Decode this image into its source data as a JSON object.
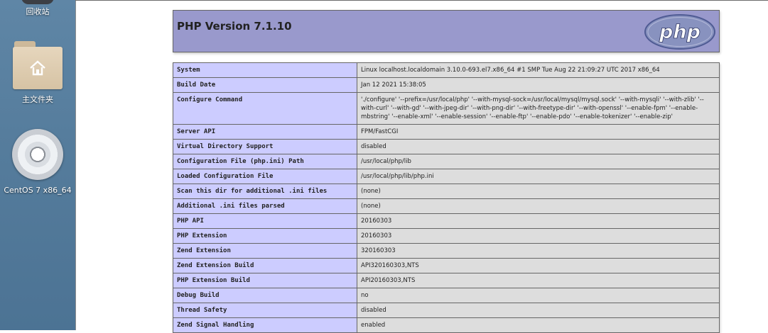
{
  "desktop": {
    "icons": [
      {
        "label": "回收站",
        "icon": "trash-icon"
      },
      {
        "label": "主文件夹",
        "icon": "home-folder-icon"
      },
      {
        "label": "CentOS 7 x86_64",
        "icon": "disc-icon"
      }
    ]
  },
  "header": {
    "title": "PHP Version 7.1.10",
    "logo_text": "php",
    "logo_color": "#8892bf"
  },
  "colors": {
    "header_bg": "#9999cc",
    "key_cell_bg": "#ccccff",
    "value_cell_bg": "#dddddd"
  },
  "info_rows": [
    {
      "key": "System",
      "value": "Linux localhost.localdomain 3.10.0-693.el7.x86_64 #1 SMP Tue Aug 22 21:09:27 UTC 2017 x86_64"
    },
    {
      "key": "Build Date",
      "value": "Jan 12 2021 15:38:05"
    },
    {
      "key": "Configure Command",
      "value": "'./configure' '--prefix=/usr/local/php' '--with-mysql-sock=/usr/local/mysql/mysql.sock' '--with-mysqli' '--with-zlib' '--with-curl' '--with-gd' '--with-jpeg-dir' '--with-png-dir' '--with-freetype-dir' '--with-openssl' '--enable-fpm' '--enable-mbstring' '--enable-xml' '--enable-session' '--enable-ftp' '--enable-pdo' '--enable-tokenizer' '--enable-zip'"
    },
    {
      "key": "Server API",
      "value": "FPM/FastCGI"
    },
    {
      "key": "Virtual Directory Support",
      "value": "disabled"
    },
    {
      "key": "Configuration File (php.ini) Path",
      "value": "/usr/local/php/lib"
    },
    {
      "key": "Loaded Configuration File",
      "value": "/usr/local/php/lib/php.ini"
    },
    {
      "key": "Scan this dir for additional .ini files",
      "value": "(none)"
    },
    {
      "key": "Additional .ini files parsed",
      "value": "(none)"
    },
    {
      "key": "PHP API",
      "value": "20160303"
    },
    {
      "key": "PHP Extension",
      "value": "20160303"
    },
    {
      "key": "Zend Extension",
      "value": "320160303"
    },
    {
      "key": "Zend Extension Build",
      "value": "API320160303,NTS"
    },
    {
      "key": "PHP Extension Build",
      "value": "API20160303,NTS"
    },
    {
      "key": "Debug Build",
      "value": "no"
    },
    {
      "key": "Thread Safety",
      "value": "disabled"
    },
    {
      "key": "Zend Signal Handling",
      "value": "enabled"
    }
  ]
}
